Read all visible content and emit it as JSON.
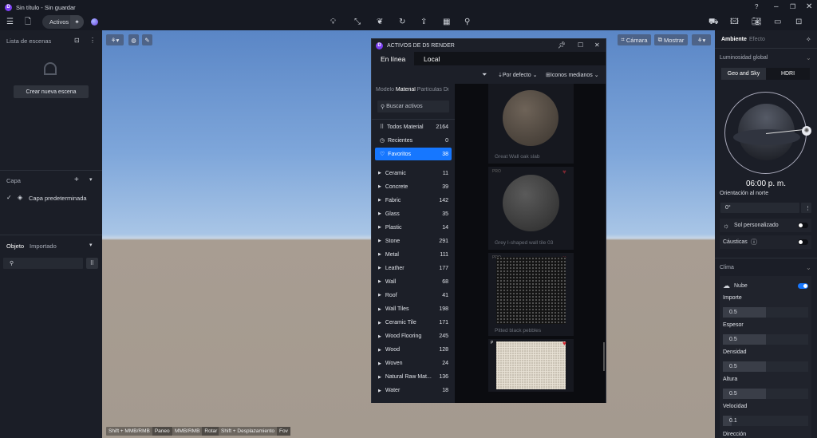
{
  "window": {
    "title": "Sin título - Sin guardar",
    "logo": "D"
  },
  "toolbar": {
    "assets_label": "Activos",
    "icons": [
      "menu-icon",
      "file-icon",
      "light-bulb-icon",
      "path-icon",
      "leaf-icon",
      "refresh-icon",
      "import-icon",
      "material-icon",
      "pin-icon",
      "render-icon",
      "image-edit-icon",
      "camera-icon",
      "video-icon",
      "gallery-icon"
    ]
  },
  "left": {
    "scenes_title": "Lista de escenas",
    "create_scene": "Crear nueva escena",
    "layer_title": "Capa",
    "default_layer": "Capa predeterminada",
    "tab_object": "Objeto",
    "tab_imported": "Importado"
  },
  "viewport": {
    "camera": "Cámara",
    "show": "Mostrar",
    "hints": [
      {
        "keys": "Shift + MMB/RMB",
        "action": "Paneo"
      },
      {
        "keys": "MMB/RMB",
        "action": "Rotar"
      },
      {
        "keys": "Shift + Desplazamiento",
        "action": "Fov"
      }
    ]
  },
  "assets": {
    "title": "ACTIVOS DE D5 RENDER",
    "tab_online": "En línea",
    "tab_local": "Local",
    "sort": "Por defecto",
    "view": "Iconos medianos",
    "type_tabs": [
      "Modelo",
      "Material",
      "Partículas",
      "Di"
    ],
    "search_placeholder": "Buscar activos",
    "quick": [
      {
        "label": "Todos Material",
        "count": "2164"
      },
      {
        "label": "Recientes",
        "count": "0"
      },
      {
        "label": "Favoritos",
        "count": "38"
      }
    ],
    "categories": [
      {
        "label": "Ceramic",
        "count": "11"
      },
      {
        "label": "Concrete",
        "count": "39"
      },
      {
        "label": "Fabric",
        "count": "142"
      },
      {
        "label": "Glass",
        "count": "35"
      },
      {
        "label": "Plastic",
        "count": "14"
      },
      {
        "label": "Stone",
        "count": "291"
      },
      {
        "label": "Metal",
        "count": "111"
      },
      {
        "label": "Leather",
        "count": "177"
      },
      {
        "label": "Wall",
        "count": "68"
      },
      {
        "label": "Roof",
        "count": "41"
      },
      {
        "label": "Wall Tiles",
        "count": "198"
      },
      {
        "label": "Ceramic Tile",
        "count": "171"
      },
      {
        "label": "Wood Flooring",
        "count": "245"
      },
      {
        "label": "Wood",
        "count": "128"
      },
      {
        "label": "Woven",
        "count": "24"
      },
      {
        "label": "Natural Raw Mat...",
        "count": "136"
      },
      {
        "label": "Water",
        "count": "18"
      }
    ],
    "cards": [
      {
        "name": "Great Wall oak slab",
        "badge": ""
      },
      {
        "name": "Grey I-shaped wall tile 03",
        "badge": "PRO"
      },
      {
        "name": "Pitted black pebbles",
        "badge": "PRO"
      },
      {
        "name": "",
        "badge": "P"
      }
    ],
    "accent": "#1677ff"
  },
  "right": {
    "tab_env": "Ambiente",
    "tab_effect": "Efecto",
    "gi_title": "Luminosidad global",
    "mode_geo": "Geo and Sky",
    "mode_hdri": "HDRI",
    "time": "06:00 p. m.",
    "north_label": "Orientación al norte",
    "north_value": "0°",
    "custom_sun": "Sol personalizado",
    "caustics": "Cáusticas",
    "custom_sun_on": false,
    "caustics_on": false,
    "climate_title": "Clima",
    "cloud": "Nube",
    "cloud_on": true,
    "sliders": [
      {
        "label": "Importe",
        "value": "0.5",
        "level": 0.5
      },
      {
        "label": "Espesor",
        "value": "0.5",
        "level": 0.5
      },
      {
        "label": "Densidad",
        "value": "0.5",
        "level": 0.5
      },
      {
        "label": "Altura",
        "value": "0.5",
        "level": 0.5
      },
      {
        "label": "Velocidad",
        "value": "0.1",
        "level": 0.1
      }
    ],
    "direction_label": "Dirección"
  }
}
